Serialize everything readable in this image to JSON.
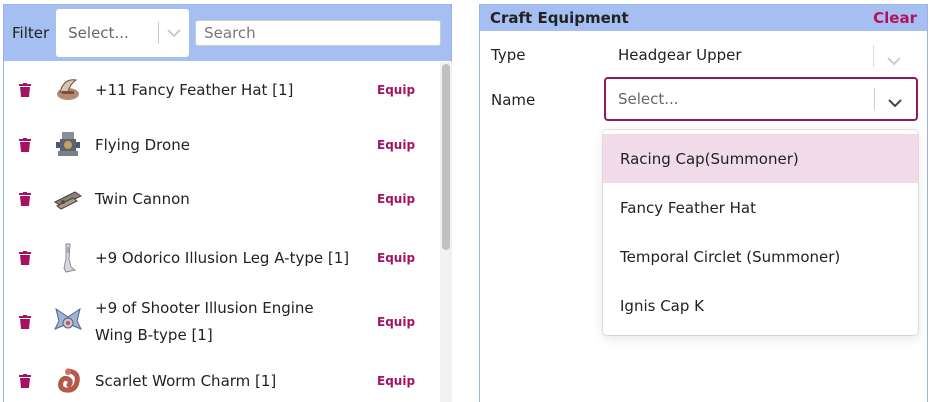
{
  "left": {
    "filter_label": "Filter",
    "filter_select_placeholder": "Select...",
    "search_placeholder": "Search",
    "equip_label": "Equip",
    "items": [
      {
        "name": "+11 Fancy Feather Hat [1]",
        "icon": "feather-hat-icon"
      },
      {
        "name": "Flying Drone",
        "icon": "drone-icon"
      },
      {
        "name": "Twin Cannon",
        "icon": "cannon-icon"
      },
      {
        "name": "+9 Odorico Illusion Leg A-type [1]",
        "icon": "leg-armor-icon"
      },
      {
        "name": "+9 of Shooter Illusion Engine Wing B-type [1]",
        "icon": "wing-icon"
      },
      {
        "name": "Scarlet Worm Charm [1]",
        "icon": "worm-charm-icon"
      }
    ]
  },
  "right": {
    "title": "Craft Equipment",
    "clear_label": "Clear",
    "type_label": "Type",
    "type_value": "Headgear Upper",
    "name_label": "Name",
    "name_placeholder": "Select...",
    "options": [
      "Racing Cap(Summoner)",
      "Fancy Feather Hat",
      "Temporal Circlet (Summoner)",
      "Ignis Cap K"
    ]
  },
  "colors": {
    "header_bg": "#a6bff2",
    "accent": "#a5125f",
    "selected_option_bg": "#f2dbe8"
  }
}
